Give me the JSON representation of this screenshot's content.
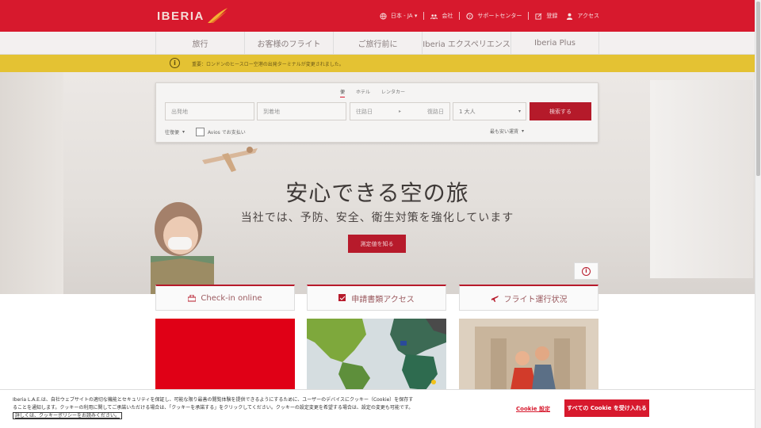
{
  "brand": {
    "logo_text": "IBERIA",
    "accent": "#d7192d"
  },
  "toplinks": [
    {
      "icon": "globe-icon",
      "label": "日本 - JA ▾"
    },
    {
      "icon": "company-icon",
      "label": "会社"
    },
    {
      "icon": "help-icon",
      "label": "サポートセンター"
    },
    {
      "icon": "register-icon",
      "label": "登録"
    },
    {
      "icon": "user-icon",
      "label": "アクセス"
    }
  ],
  "nav": [
    "旅行",
    "お客様のフライト",
    "ご旅行前に",
    "Iberia エクスペリエンス",
    "Iberia Plus"
  ],
  "alert": {
    "text": "重要：ロンドンのヒースロー空港の出発ターミナルが変更されました。"
  },
  "search": {
    "tabs": [
      "便",
      "ホテル",
      "レンタカー"
    ],
    "origin_placeholder": "出発地",
    "destination_placeholder": "到着地",
    "depart_placeholder": "往路日",
    "return_placeholder": "復路日",
    "passengers": "1 大人",
    "submit": "検索する",
    "trip_type": "往復便",
    "avios_label": "Avios でお支払い",
    "sort": "最も安い運賃"
  },
  "hero": {
    "headline": "安心できる空の旅",
    "subline": "当社では、予防、安全、衛生対策を強化しています",
    "button": "測定値を知る"
  },
  "quick_links": [
    {
      "icon": "checkin-icon",
      "label": "Check-in online"
    },
    {
      "icon": "documents-icon",
      "label": "申請書類アクセス"
    },
    {
      "icon": "plane-icon",
      "label": "フライト運行状況"
    }
  ],
  "cookie": {
    "text": "Iberia L.A.E.は、自社ウェブサイトの適切な機能とセキュリティを保証し、可能な限り最善の閲覧体験を提供できるようにするために、ユーザーのデバイスにクッキー（Cookie）を保存することを通知します。クッキーの利用に関してご承諾いただける場合は、「クッキーを承諾する」をクリックしてください。クッキーの設定変更を希望する場合は、設定の変更も可能です。",
    "link": "詳しくは、クッキーポリシーをお読みください。",
    "settings": "Cookie 設定",
    "accept": "すべての Cookie を受け入れる"
  }
}
